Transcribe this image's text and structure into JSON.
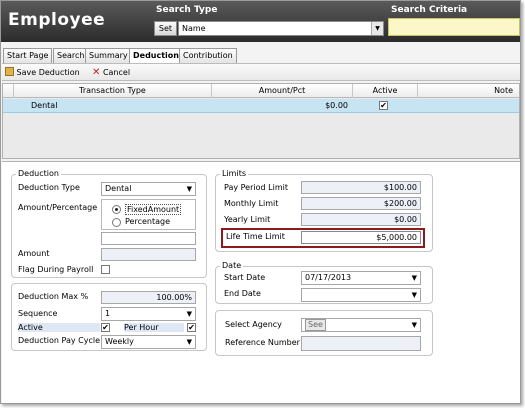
{
  "header": {
    "title": "Employee",
    "search_type_label": "Search Type",
    "search_criteria_label": "Search Criteria",
    "set_button": "Set",
    "search_type_value": "Name"
  },
  "tabs": [
    {
      "label": "Start Page"
    },
    {
      "label": "Search"
    },
    {
      "label": "Summary"
    },
    {
      "label": "Deduction"
    },
    {
      "label": "Contribution"
    }
  ],
  "toolbar": {
    "save_label": "Save Deduction",
    "cancel_label": "Cancel"
  },
  "grid": {
    "columns": [
      "Transaction Type",
      "Amount/Pct",
      "Active",
      "Note"
    ],
    "rows": [
      {
        "type": "Dental",
        "amount": "$0.00",
        "active": "✔"
      }
    ]
  },
  "deduction": {
    "legend": "Deduction",
    "type_label": "Deduction Type",
    "type_value": "Dental",
    "amount_pct_label": "Amount/Percentage",
    "fixed_label": "FixedAmount",
    "pct_label": "Percentage",
    "amount_label": "Amount",
    "flag_label": "Flag During Payroll"
  },
  "deduction2": {
    "max_label": "Deduction Max %",
    "max_value": "100.00%",
    "sequence_label": "Sequence",
    "sequence_value": "1",
    "active_label": "Active",
    "per_hour_label": "Per Hour",
    "cycle_label": "Deduction Pay Cycle",
    "cycle_value": "Weekly"
  },
  "limits": {
    "legend": "Limits",
    "pay_period_label": "Pay Period Limit",
    "pay_period_value": "$100.00",
    "monthly_label": "Monthly Limit",
    "monthly_value": "$200.00",
    "yearly_label": "Yearly Limit",
    "yearly_value": "$0.00",
    "lifetime_label": "Life Time Limit",
    "lifetime_value": "$5,000.00"
  },
  "date": {
    "legend": "Date",
    "start_label": "Start Date",
    "start_value": "07/17/2013",
    "end_label": "End Date"
  },
  "agency": {
    "select_label": "Select Agency",
    "see_button": "See",
    "ref_label": "Reference Number"
  },
  "colors": {
    "header_bg": "#3a3a3a",
    "criteria_bg": "#fbf7c8",
    "row_selected": "#c7e4f3",
    "highlight_border": "#8c1c1c"
  }
}
